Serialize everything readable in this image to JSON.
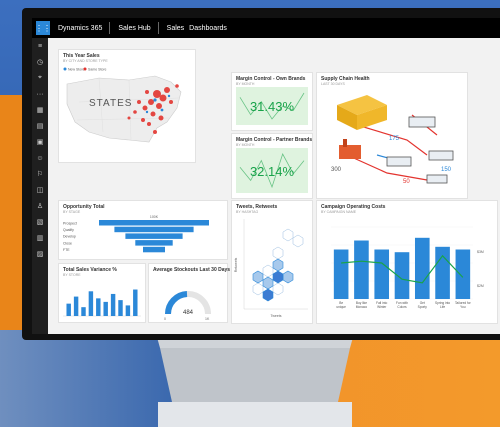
{
  "app": {
    "name": "Dynamics 365",
    "module": "Sales Hub",
    "nav": [
      "Sales",
      "Dashboards"
    ]
  },
  "sidebar": {
    "icons": [
      "menu-icon",
      "recent-icon",
      "pin-icon",
      "more-icon",
      "dashboard-icon",
      "activities-icon",
      "accounts-icon",
      "contacts-icon",
      "leads-icon",
      "opportunities-icon",
      "competitors-icon",
      "products-icon",
      "documents-icon",
      "reports-icon"
    ]
  },
  "cards": {
    "sales": {
      "title": "This Year Sales",
      "subtitle": "BY CITY AND STORE TYPE",
      "legend": [
        "New Store",
        "Same Store"
      ],
      "map_label": "STATES"
    },
    "own": {
      "title": "Margin Control - Own Brands",
      "subtitle": "BY MONTH",
      "value": "31.43%"
    },
    "partner": {
      "title": "Margin Control - Partner Brands",
      "subtitle": "BY MONTH",
      "value": "32.14%"
    },
    "supply": {
      "title": "Supply Chain Health",
      "subtitle": "LAST 30 DAYS",
      "labels": [
        "175",
        "300",
        "50",
        "150"
      ]
    },
    "opp": {
      "title": "Opportunity Total",
      "subtitle": "BY STAGE",
      "stages": [
        "Prospect",
        "Qualify",
        "Develop",
        "Close",
        "FTE"
      ],
      "top_label": "100K"
    },
    "tweets": {
      "title": "Tweets, Retweets",
      "subtitle": "BY HASHTAG",
      "xlabel": "Tweets",
      "ylabel": "Retweets"
    },
    "campaign": {
      "title": "Campaign Operating Costs",
      "subtitle": "BY CAMPAIGN NAME",
      "right_ticks": [
        "$3M",
        "$2M"
      ]
    },
    "variance": {
      "title": "Total Sales Variance %",
      "subtitle": "BY STORE"
    },
    "stockouts": {
      "title": "Average Stockouts Last 30 Days",
      "value": "484",
      "min": "0",
      "max": "1K"
    }
  },
  "chart_data": [
    {
      "type": "bar",
      "title": "Opportunity Total",
      "categories": [
        "Prospect",
        "Qualify",
        "Develop",
        "Close",
        "FTE"
      ],
      "values": [
        100,
        72,
        52,
        34,
        20
      ]
    },
    {
      "type": "bar",
      "title": "Campaign Operating Costs",
      "categories": [
        "Be unique",
        "Buy like Monaco",
        "Fall into Winter",
        "Fun with Colors",
        "Get Sporty",
        "Spring into Life",
        "Tailored for You"
      ],
      "series": [
        {
          "values": [
            55,
            65,
            55,
            52,
            68,
            58,
            55
          ],
          "color": "#2b88d8"
        },
        {
          "values": [
            40,
            42,
            40,
            22,
            18,
            48,
            24
          ],
          "color": "#19a34a"
        }
      ]
    },
    {
      "type": "bar",
      "title": "Total Sales Variance %",
      "values": [
        14,
        22,
        10,
        28,
        20,
        16,
        25,
        18,
        12,
        30
      ],
      "color": "#2b88d8"
    },
    {
      "type": "line",
      "title": "Margin Control - Own Brands",
      "values": [
        7,
        3,
        6,
        2,
        5,
        4,
        8
      ],
      "color": "#19a34a"
    },
    {
      "type": "line",
      "title": "Margin Control - Partner Brands",
      "values": [
        6,
        4,
        7,
        3,
        8,
        5,
        7
      ],
      "color": "#19a34a"
    },
    {
      "type": "gauge",
      "title": "Average Stockouts Last 30 Days",
      "value": 484,
      "min": 0,
      "max": 1000
    }
  ]
}
